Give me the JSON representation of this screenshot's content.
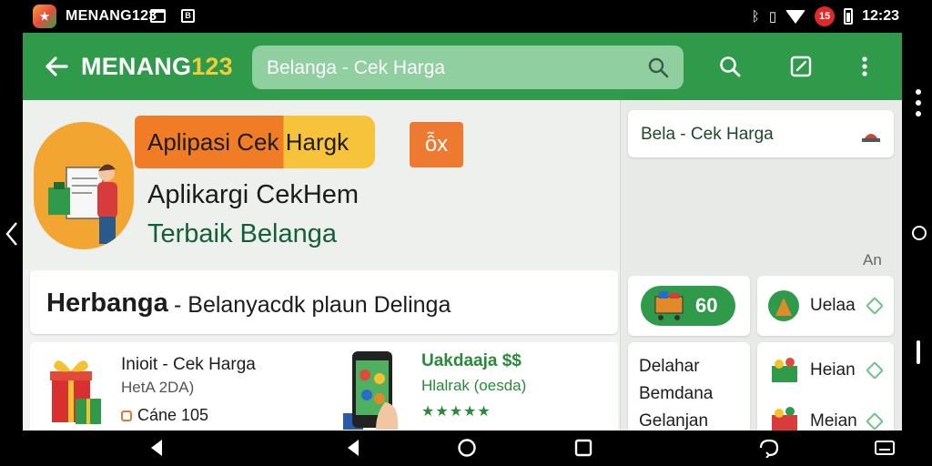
{
  "status_bar": {
    "app_title": "MENANG123",
    "time": "12:23",
    "notification_count": "15",
    "ic2_text": "B"
  },
  "toolbar": {
    "brand_main": "MENANG",
    "brand_num": "123",
    "search_placeholder": "Belanga - Cek Harga"
  },
  "banner": {
    "promo_text": "Aplipasi Cek Hargk",
    "badge": "ỗx",
    "headline": "Aplikargi CekHem",
    "subhead": "Terbaik Belanga"
  },
  "row_card": {
    "title": "Herbanga",
    "subtitle": "- Belanyacdk plaun Delinga"
  },
  "products": [
    {
      "name": "Inioit - Cek Harga",
      "line1": "HetA 2DA)",
      "line2": "Cáne 105"
    },
    {
      "name": "Uakdaaja $$",
      "line1": "Hlalrak (oesda)",
      "stars": "★★★★★"
    }
  ],
  "right_panel": {
    "search_card_title": "Bela - Cek Harga",
    "section_label": "An",
    "cart_count": "60",
    "side_items": [
      "Uelaa",
      "Heian",
      "Meian"
    ],
    "list_items": [
      "Delahar",
      "Bemdana",
      "Gelanjan"
    ]
  },
  "colors": {
    "primary_green": "#2f9a4a",
    "accent_orange": "#f07d26",
    "accent_yellow": "#f6c33a"
  }
}
